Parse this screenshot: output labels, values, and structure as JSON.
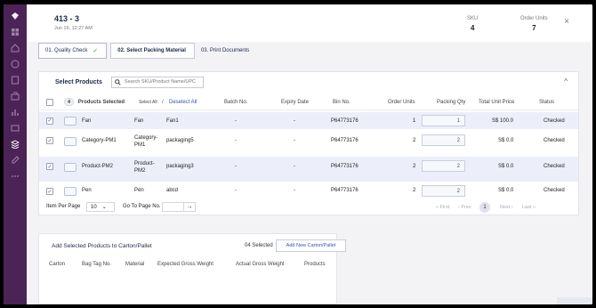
{
  "header": {
    "title": "413 - 3",
    "subtitle": "Jun 16, 12:27 AM",
    "sku_label": "SKU",
    "sku_value": "4",
    "order_units_label": "Order Units",
    "order_units_value": "7",
    "close_label": "×"
  },
  "steps": [
    {
      "label": "01. Quality Check",
      "state": "done"
    },
    {
      "label": "02. Select Packing Material",
      "state": "active"
    },
    {
      "label": "03. Print Documents",
      "state": "pending"
    }
  ],
  "select_products": {
    "title": "Select Products",
    "search_placeholder": "Search SKU/Product Name/UPC",
    "collapse_icon": "^",
    "selected_count": "4",
    "selected_label": "Products Selected",
    "select_all": "Select All",
    "separator": "/",
    "deselect_all": "Deselect All",
    "columns": [
      "Batch No.",
      "Expiry Date",
      "Bin No.",
      "Order Units",
      "Packing Qty",
      "Total Unit Price",
      "Status"
    ],
    "rows": [
      {
        "name": "Fan",
        "sku": "Fan",
        "material": "Fan1",
        "batch": "-",
        "expiry": "-",
        "bin": "P64773176",
        "order_units": "1",
        "packing_qty": "1",
        "price": "S$ 100.0",
        "status": "Checked"
      },
      {
        "name": "Category-PM1",
        "sku": "Category-PM1",
        "material": "packaging5",
        "batch": "-",
        "expiry": "-",
        "bin": "P64773176",
        "order_units": "2",
        "packing_qty": "2",
        "price": "S$ 0.0",
        "status": "Checked"
      },
      {
        "name": "Product-PM2",
        "sku": "Product-PM2",
        "material": "packaging3",
        "batch": "-",
        "expiry": "-",
        "bin": "P64773176",
        "order_units": "2",
        "packing_qty": "2",
        "price": "S$ 0.0",
        "status": "Checked"
      },
      {
        "name": "Pen",
        "sku": "Pen",
        "material": "abcd",
        "batch": "-",
        "expiry": "-",
        "bin": "P64773176",
        "order_units": "2",
        "packing_qty": "2",
        "price": "S$ 0.0",
        "status": "Checked"
      }
    ],
    "pager": {
      "items_per_page_label": "Item Per Page",
      "items_per_page_value": "10",
      "goto_label": "Go To Page No.",
      "goto_arrow": "→",
      "first": "« First",
      "prev": "‹ Prev",
      "current": "1",
      "next": "Next ›",
      "last": "Last »"
    }
  },
  "carton": {
    "title": "Add Selected Products to Carton/Pallet",
    "count": "04 Selected",
    "add_button": "Add New Carton/Pallet",
    "columns": [
      "Carton",
      "Bag Tag No.",
      "Material",
      "Expected Gross Weight",
      "Actual Gross Weight",
      "Products"
    ]
  },
  "colors": {
    "sidebar": "#4b2357",
    "accent": "#3b4fb8",
    "check": "#3aa15a",
    "row_alt": "#eceff9"
  }
}
